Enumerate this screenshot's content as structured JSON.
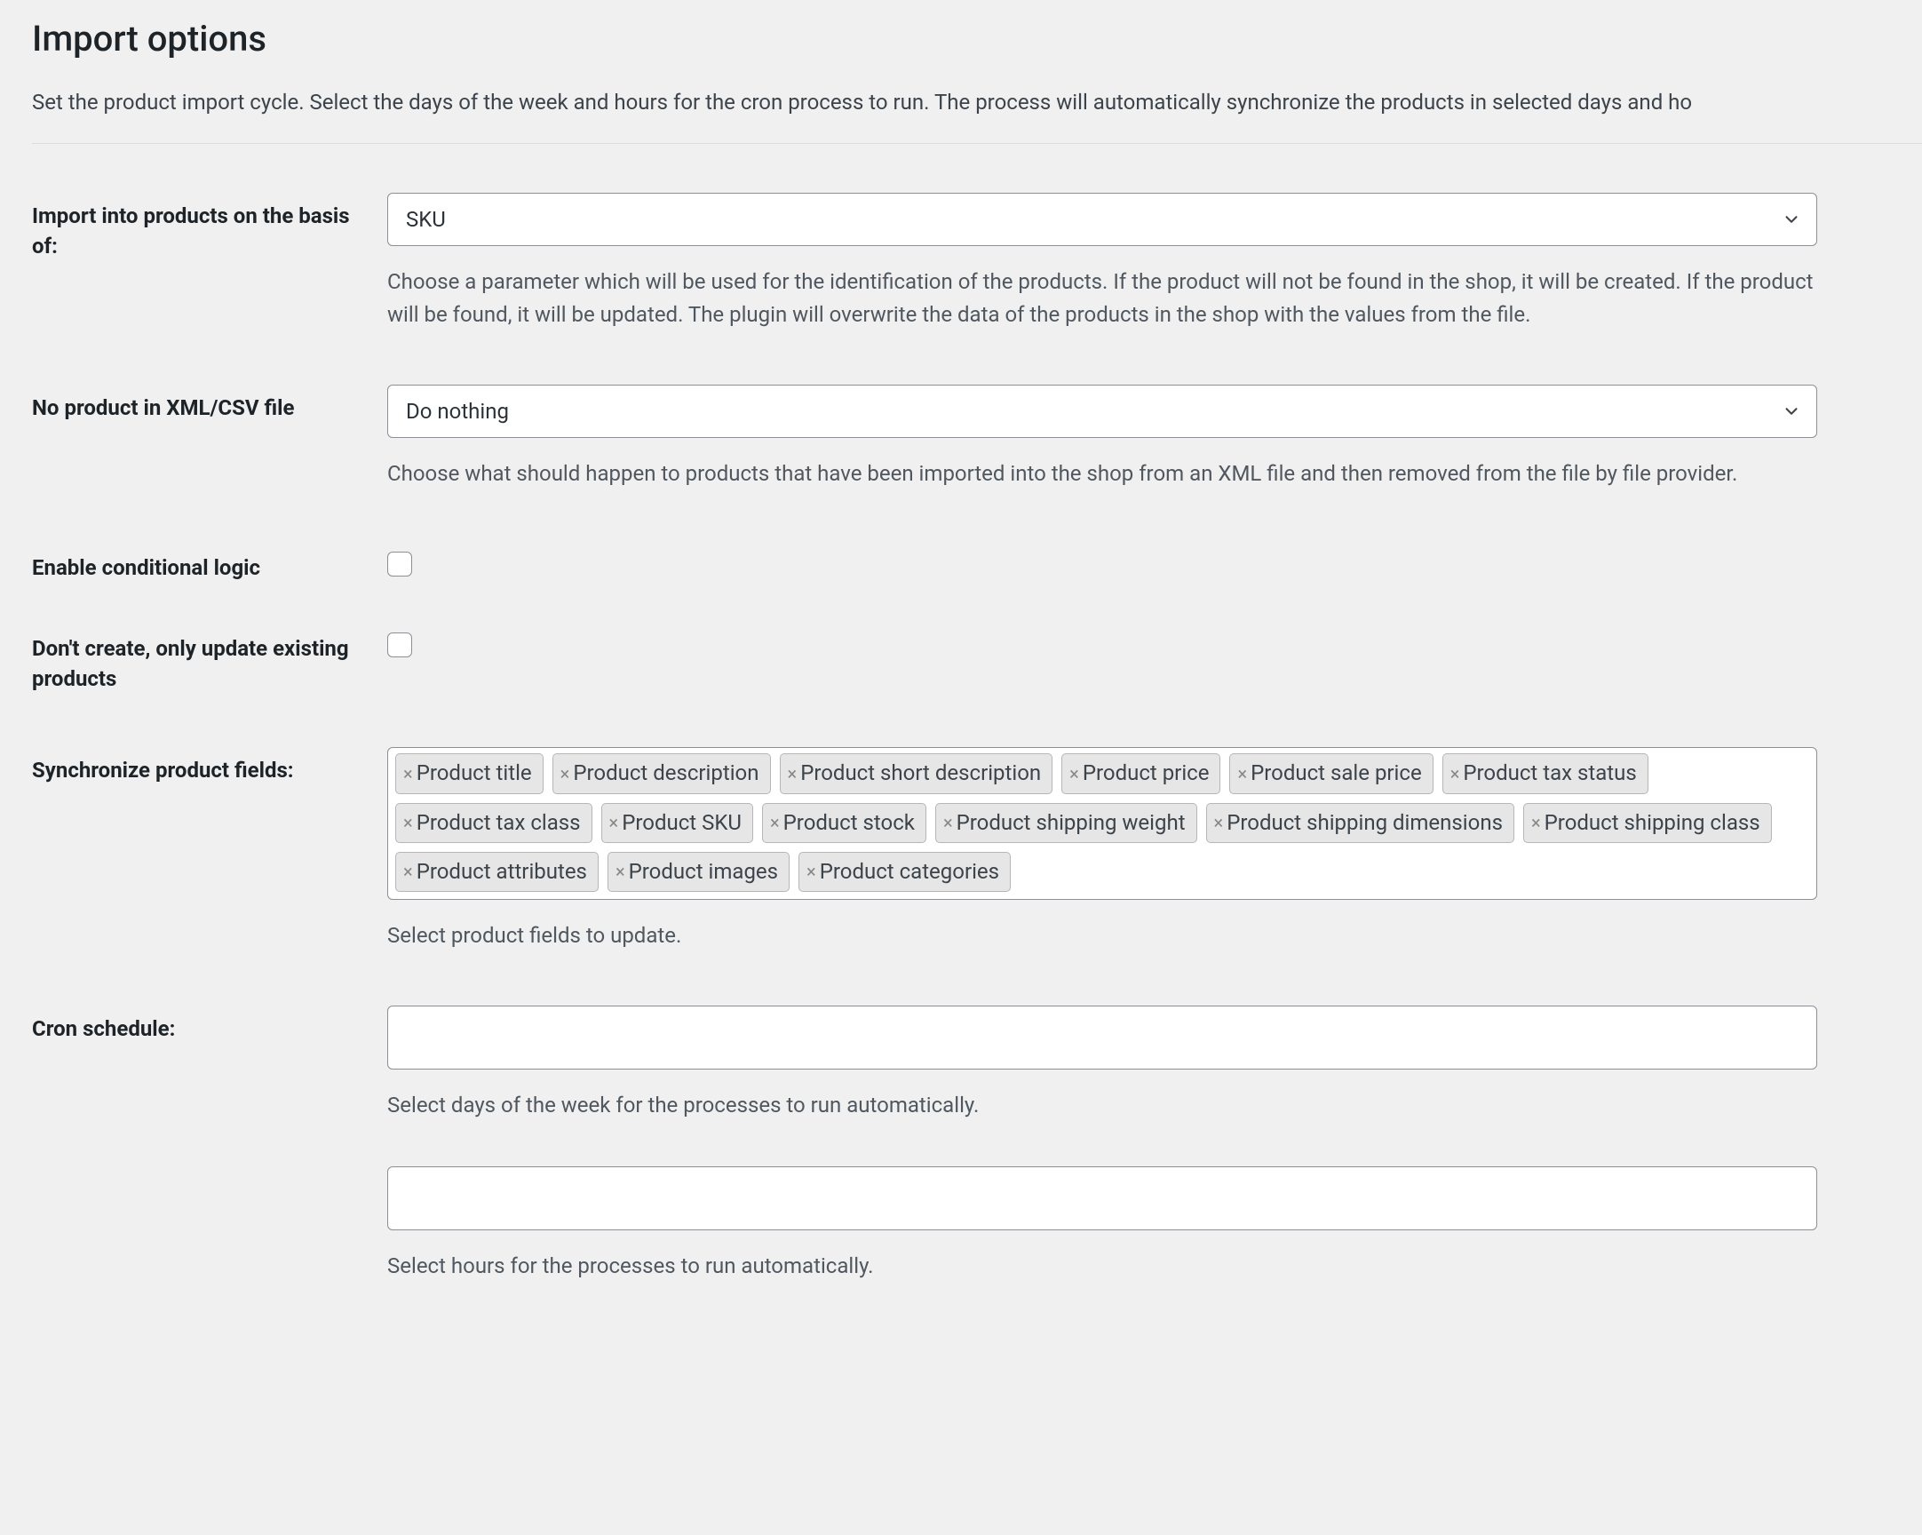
{
  "title": "Import options",
  "intro": "Set the product import cycle. Select the days of the week and hours for the cron process to run. The process will automatically synchronize the products in selected days and ho",
  "fields": {
    "basis": {
      "label": "Import into products on the basis of:",
      "selected": "SKU",
      "helper": "Choose a parameter which will be used for the identification of the products. If the product will not be found in the shop, it will be created. If the product will be found, it will be updated. The plugin will overwrite the data of the products in the shop with the values from the file."
    },
    "no_product": {
      "label": "No product in XML/CSV file",
      "selected": "Do nothing",
      "helper": "Choose what should happen to products that have been imported into the shop from an XML file and then removed from the file by file provider."
    },
    "conditional": {
      "label": "Enable conditional logic"
    },
    "only_update": {
      "label": "Don't create, only update existing products"
    },
    "sync": {
      "label": "Synchronize product fields:",
      "tags": [
        "Product title",
        "Product description",
        "Product short description",
        "Product price",
        "Product sale price",
        "Product tax status",
        "Product tax class",
        "Product SKU",
        "Product stock",
        "Product shipping weight",
        "Product shipping dimensions",
        "Product shipping class",
        "Product attributes",
        "Product images",
        "Product categories"
      ],
      "helper": "Select product fields to update."
    },
    "cron": {
      "label": "Cron schedule:",
      "days_helper": "Select days of the week for the processes to run automatically.",
      "hours_helper": "Select hours for the processes to run automatically."
    }
  }
}
